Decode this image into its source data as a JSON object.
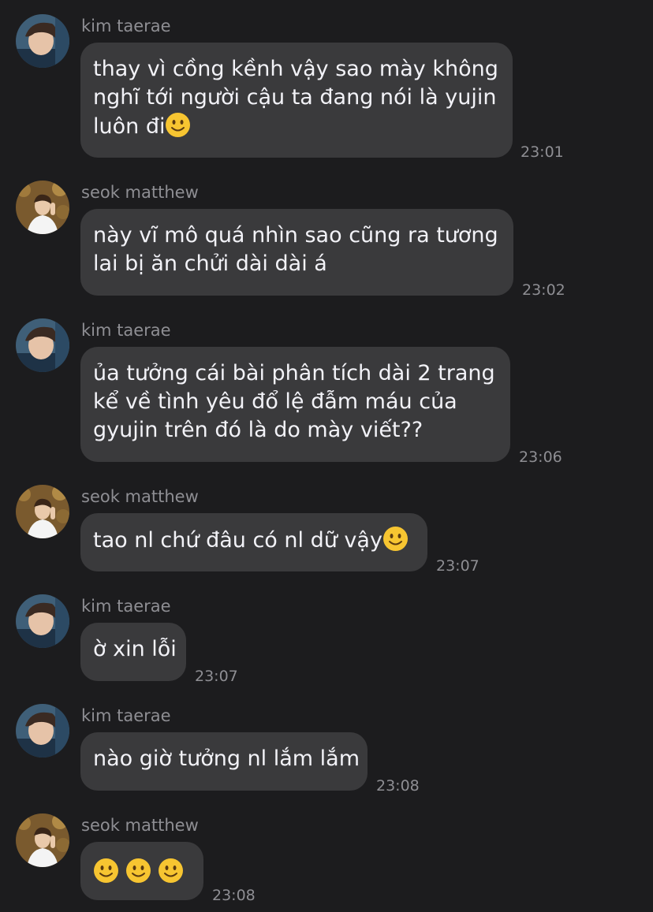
{
  "chat": {
    "messages": [
      {
        "sender": "kim taerae",
        "lines": [
          "thay vì cồng kềnh vậy sao mày không",
          "nghĩ tới người cậu ta đang nói là yujin",
          "luôn đi"
        ],
        "trailing_emoji": "slightly-smiling-face",
        "time": "23:01"
      },
      {
        "sender": "seok matthew",
        "lines": [
          "này vĩ mô quá nhìn sao cũng ra tương",
          "lai bị ăn chửi dài dài á"
        ],
        "time": "23:02"
      },
      {
        "sender": "kim taerae",
        "lines": [
          "ủa tưởng cái bài phân tích dài 2 trang",
          "kể về tình yêu đổ lệ đẫm máu của",
          "gyujin trên đó là do mày viết??"
        ],
        "time": "23:06"
      },
      {
        "sender": "seok matthew",
        "lines": [
          "tao nl chứ đâu có nl dữ vậy"
        ],
        "trailing_emoji": "slightly-smiling-face",
        "time": "23:07"
      },
      {
        "sender": "kim taerae",
        "lines": [
          "ờ xin lỗi"
        ],
        "time": "23:07"
      },
      {
        "sender": "kim taerae",
        "lines": [
          "nào giờ tưởng nl lắm lắm"
        ],
        "time": "23:08"
      },
      {
        "sender": "seok matthew",
        "emojis": [
          "slightly-smiling-face",
          "slightly-smiling-face",
          "slightly-smiling-face"
        ],
        "time": "23:08"
      }
    ]
  },
  "colors": {
    "background": "#1c1c1e",
    "bubble": "#3a3a3c",
    "message_text": "#f2f2f7",
    "meta_text": "#8e8e93",
    "emoji_face": "#f7c531"
  }
}
